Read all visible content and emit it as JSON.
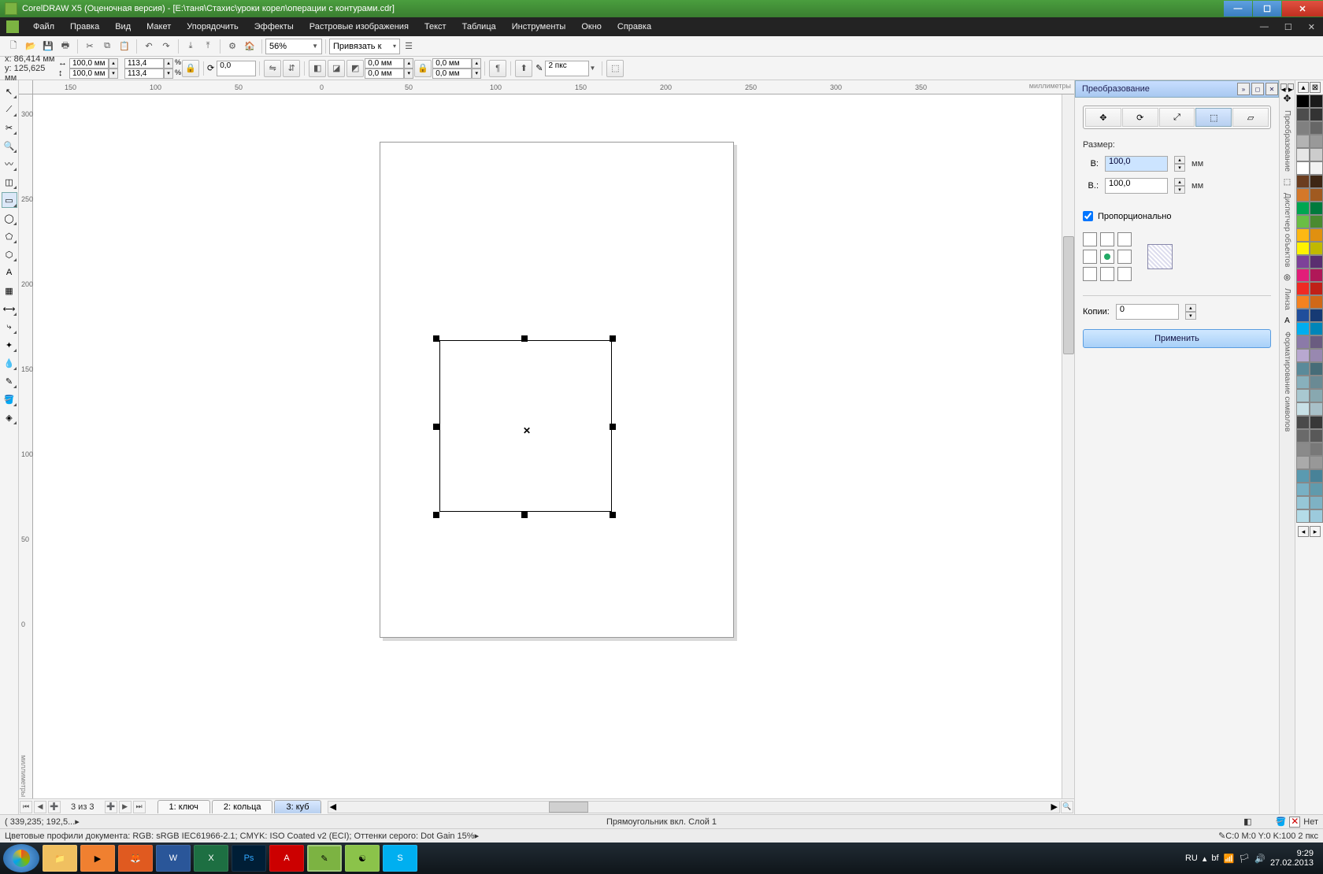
{
  "titlebar": {
    "text": "CorelDRAW X5 (Оценочная версия) - [E:\\таня\\Стахис\\уроки корел\\операции с контурами.cdr]"
  },
  "menu": {
    "file": "Файл",
    "edit": "Правка",
    "view": "Вид",
    "layout": "Макет",
    "arrange": "Упорядочить",
    "effects": "Эффекты",
    "bitmaps": "Растровые изображения",
    "text": "Текст",
    "table": "Таблица",
    "tools": "Инструменты",
    "window": "Окно",
    "help": "Справка"
  },
  "toolbar1": {
    "zoom": "56%",
    "bind": "Привязать к"
  },
  "propertybar": {
    "x_label": "x:",
    "x": "86,414 мм",
    "y_label": "y:",
    "y": "125,625 мм",
    "width": "100,0 мм",
    "height": "100,0 мм",
    "scalex": "113,4",
    "scaley": "113,4",
    "rotation": "0,0",
    "corner1": "0,0 мм",
    "corner2": "0,0 мм",
    "corner3": "0,0 мм",
    "corner4": "0,0 мм",
    "outline": "2 пкс"
  },
  "ruler_units": "миллиметры",
  "hruler_ticks": [
    "150",
    "100",
    "50",
    "0",
    "50",
    "100",
    "150",
    "200",
    "250",
    "300",
    "350"
  ],
  "vruler_ticks": [
    "300",
    "250",
    "200",
    "150",
    "100",
    "50",
    "0"
  ],
  "pages": {
    "counter": "3 из 3",
    "tab1": "1: ключ",
    "tab2": "2: кольца",
    "tab3": "3: куб"
  },
  "docker": {
    "title": "Преобразование",
    "size_label": "Размер:",
    "w_label": "В:",
    "w_value": "100,0",
    "h_label": "В.:",
    "h_value": "100,0",
    "unit": "мм",
    "proportional": "Пропорционально",
    "copies_label": "Копии:",
    "copies": "0",
    "apply": "Применить",
    "sidetabs": [
      "Преобразование",
      "Диспетчер объектов",
      "Линза",
      "Форматирование символов"
    ]
  },
  "status1": {
    "coords": "( 339,235; 192,5... ",
    "object": "Прямоугольник вкл. Слой 1",
    "nofill": "Нет",
    "outline_info": "C:0 M:0 Y:0 K:100  2 пкс"
  },
  "status2": {
    "profiles": "Цветовые профили документа: RGB: sRGB IEC61966-2.1; CMYK: ISO Coated v2 (ECI); Оттенки серого: Dot Gain 15% "
  },
  "tray": {
    "lang": "RU",
    "time": "9:29",
    "date": "27.02.2013"
  },
  "palette_rows": [
    [
      "#000000",
      "#1a1a1a"
    ],
    [
      "#4d4d4d",
      "#333333"
    ],
    [
      "#808080",
      "#666666"
    ],
    [
      "#b3b3b3",
      "#999999"
    ],
    [
      "#e6e6e6",
      "#cccccc"
    ],
    [
      "#ffffff",
      "#f2f2f2"
    ],
    [
      "#6b3d1f",
      "#3d2614"
    ],
    [
      "#d4782a",
      "#a05a20"
    ],
    [
      "#00a651",
      "#007a3d"
    ],
    [
      "#6abe45",
      "#4a8a30"
    ],
    [
      "#fdb813",
      "#e09010"
    ],
    [
      "#fff200",
      "#c0b800"
    ],
    [
      "#7d4199",
      "#5a2e70"
    ],
    [
      "#e21e79",
      "#b01858"
    ],
    [
      "#ee2a24",
      "#c02018"
    ],
    [
      "#f58220",
      "#d06818"
    ],
    [
      "#1f4e9c",
      "#163a74"
    ],
    [
      "#00adef",
      "#0085b8"
    ],
    [
      "#8b7aa8",
      "#6a5c80"
    ],
    [
      "#b8a8d0",
      "#9888b0"
    ],
    [
      "#5a8a9a",
      "#466c78"
    ],
    [
      "#88b0bc",
      "#6a8a94"
    ],
    [
      "#a8c8d0",
      "#88a8b0"
    ],
    [
      "#c8e0e6",
      "#a8c0c8"
    ],
    [
      "#4a4a4a",
      "#383838"
    ],
    [
      "#6a6a6a",
      "#585858"
    ],
    [
      "#8a8a8a",
      "#787878"
    ],
    [
      "#aaaaaa",
      "#989898"
    ],
    [
      "#5a9ab0",
      "#488298"
    ],
    [
      "#78b0c4",
      "#609aac"
    ],
    [
      "#96c6d6",
      "#7eb2c4"
    ],
    [
      "#b4dce8",
      "#9ccadc"
    ]
  ]
}
